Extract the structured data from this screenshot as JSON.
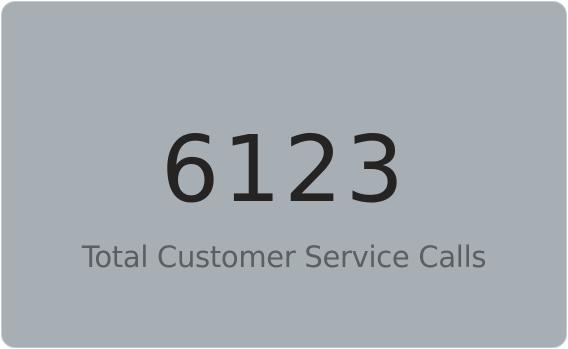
{
  "card": {
    "value": "6123",
    "label": "Total Customer Service Calls"
  },
  "colors": {
    "card_background": "#a7aeb4",
    "value_text": "#252423",
    "label_text": "#5a5f63"
  }
}
